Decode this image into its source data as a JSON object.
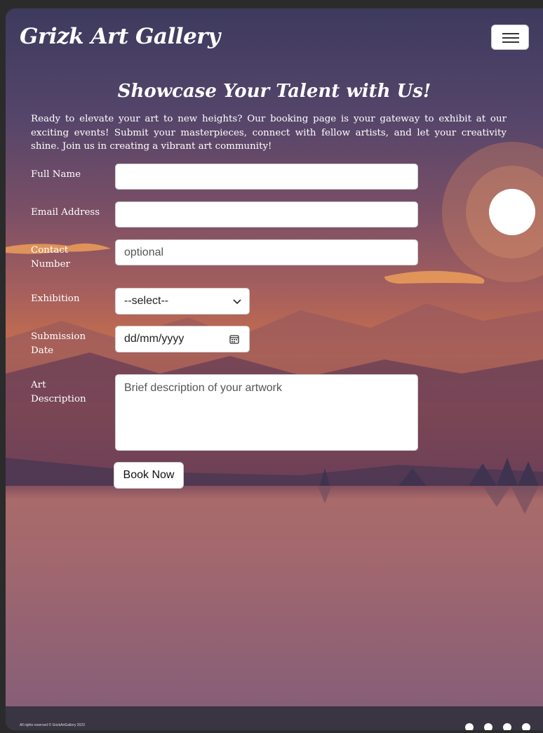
{
  "brand": "Grizk Art Gallery",
  "nav": {
    "toggle_icon": "hamburger-menu-icon"
  },
  "heading": "Showcase Your Talent with Us!",
  "intro": "Ready to elevate your art to new heights? Our booking page is your gateway to exhibit at our exciting events! Submit your masterpieces, connect with fellow artists, and let your creativity shine. Join us in creating a vibrant art community!",
  "form": {
    "full_name": {
      "label": "Full Name",
      "value": "",
      "placeholder": ""
    },
    "email": {
      "label": "Email Address",
      "value": "",
      "placeholder": ""
    },
    "contact": {
      "label": "Contact Number",
      "value": "",
      "placeholder": "optional"
    },
    "exhibition": {
      "label": "Exhibition",
      "selected": "--select--"
    },
    "date": {
      "label": "Submission Date",
      "value": "dd/mm/yyyy"
    },
    "description": {
      "label": "Art Description",
      "placeholder": "Brief description of your artwork"
    },
    "submit_label": "Book Now"
  },
  "footer": {
    "copyright": "All rights reserved © GrizkArtGallery 2023",
    "social_icons": [
      "facebook-icon",
      "twitter-icon",
      "instagram-icon",
      "youtube-icon"
    ]
  },
  "colors": {
    "sky_top": "#3d3a5e",
    "sunset": "#c8704a",
    "water": "#a96b6b",
    "footer": "#3a3542"
  }
}
